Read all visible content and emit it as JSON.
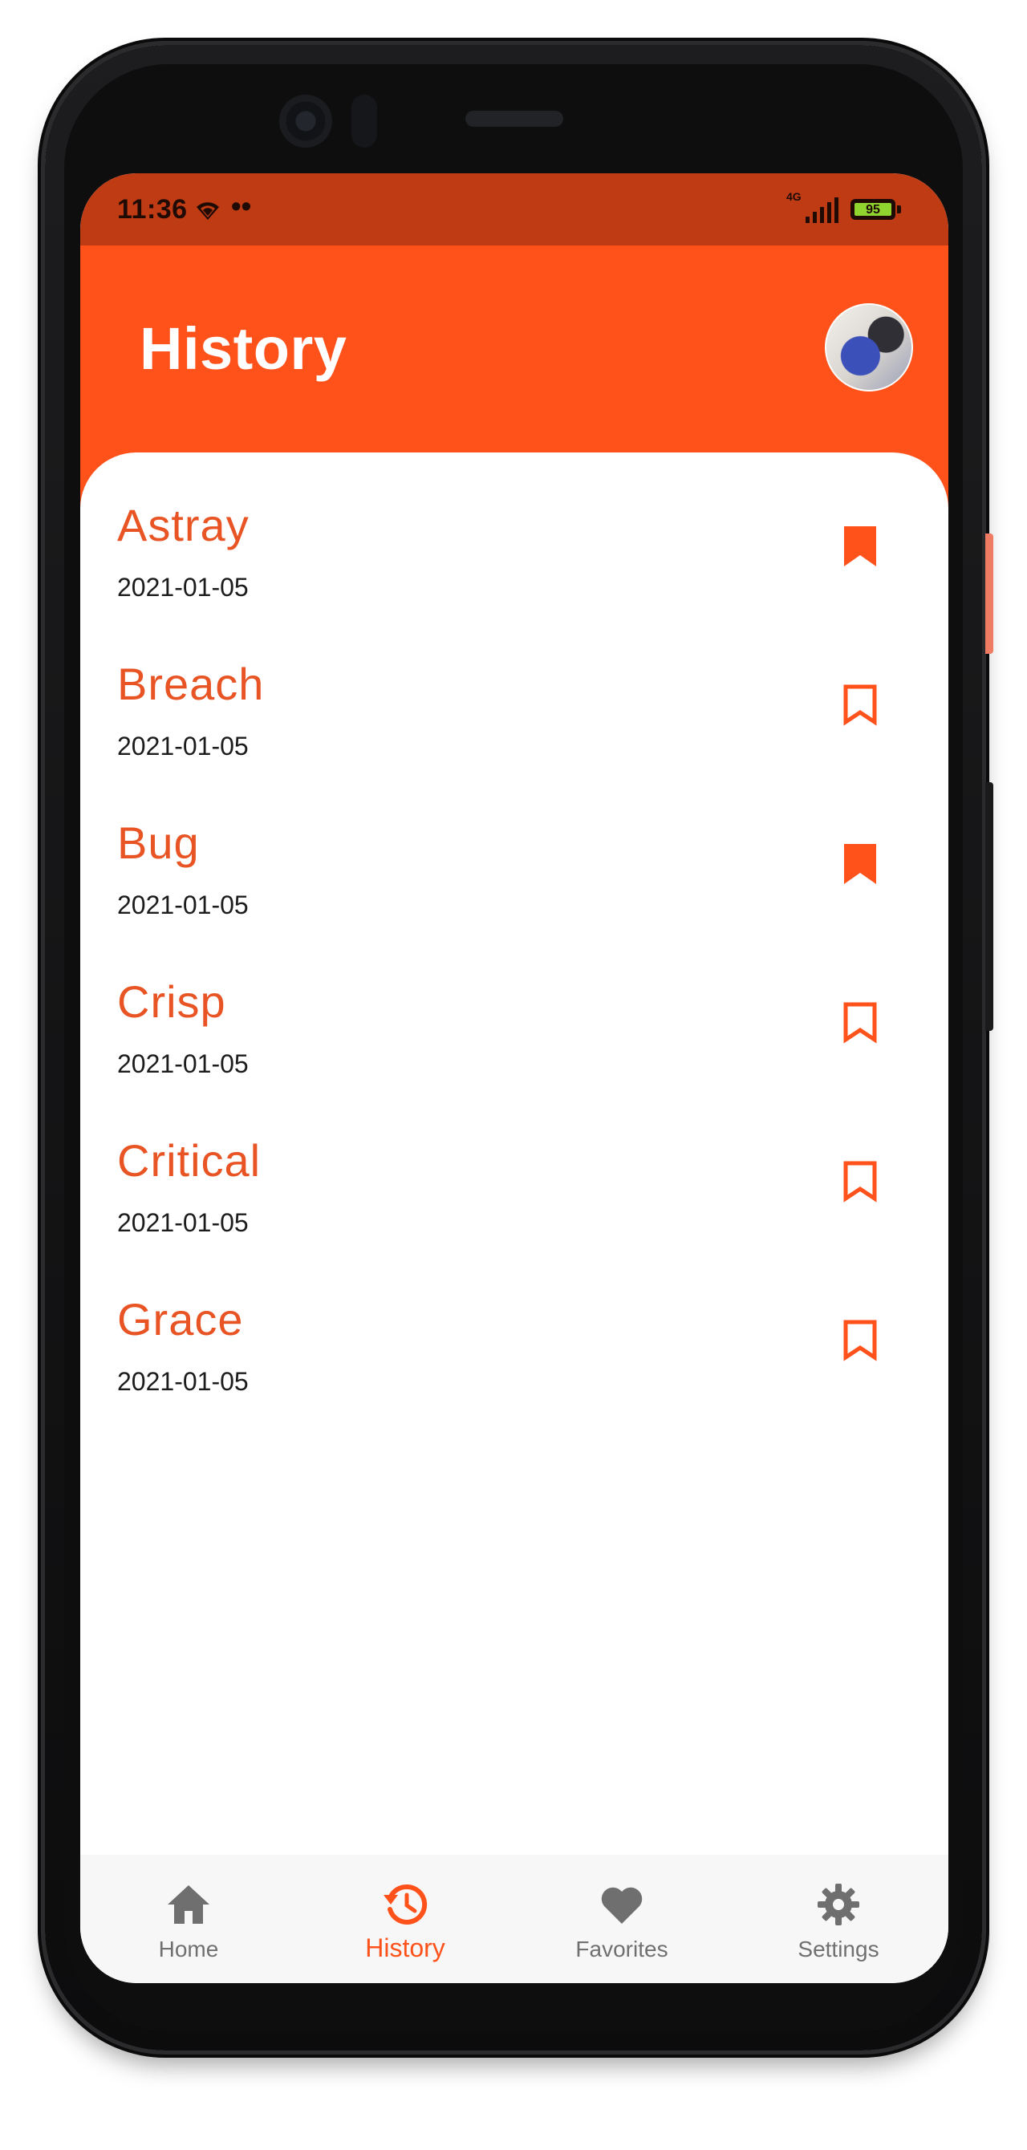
{
  "status_bar": {
    "time": "11:36",
    "dots": "••",
    "network": "4G",
    "battery": "95"
  },
  "header": {
    "title": "History",
    "avatar_icon": "profile-avatar"
  },
  "history": {
    "items": [
      {
        "word": "Astray",
        "date": "2021-01-05",
        "bookmarked": true
      },
      {
        "word": "Breach",
        "date": "2021-01-05",
        "bookmarked": false
      },
      {
        "word": "Bug",
        "date": "2021-01-05",
        "bookmarked": true
      },
      {
        "word": "Crisp",
        "date": "2021-01-05",
        "bookmarked": false
      },
      {
        "word": "Critical",
        "date": "2021-01-05",
        "bookmarked": false
      },
      {
        "word": "Grace",
        "date": "2021-01-05",
        "bookmarked": false
      }
    ]
  },
  "bottom_nav": {
    "items": [
      {
        "label": "Home",
        "icon": "home-icon",
        "active": false
      },
      {
        "label": "History",
        "icon": "history-icon",
        "active": true
      },
      {
        "label": "Favorites",
        "icon": "heart-icon",
        "active": false
      },
      {
        "label": "Settings",
        "icon": "gear-icon",
        "active": false
      }
    ]
  },
  "colors": {
    "accent": "#ff521b",
    "status_bar": "#bf3b14",
    "word_text": "#e85423",
    "nav_inactive": "#707070"
  }
}
